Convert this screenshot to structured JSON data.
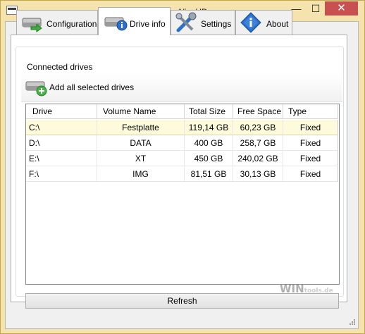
{
  "window": {
    "title": "KeepAliveHD",
    "buttons": {
      "minimize": "—",
      "maximize": "☐",
      "close": "✕"
    }
  },
  "tabs": [
    {
      "label": "Configuration",
      "icon": "drive-arrow-icon",
      "active": false
    },
    {
      "label": "Drive info",
      "icon": "drive-info-icon",
      "active": true
    },
    {
      "label": "Settings",
      "icon": "tools-icon",
      "active": false
    },
    {
      "label": "About",
      "icon": "info-diamond-icon",
      "active": false
    }
  ],
  "group": {
    "title": "Connected drives",
    "add_label": "Add all selected drives",
    "add_icon": "drive-add-icon"
  },
  "table": {
    "columns": [
      "Drive",
      "Volume Name",
      "Total Size",
      "Free Space",
      "Type"
    ],
    "rows": [
      {
        "drive": "C:\\",
        "volume": "Festplatte",
        "total": "119,14 GB",
        "free": "60,23 GB",
        "type": "Fixed",
        "selected": true
      },
      {
        "drive": "D:\\",
        "volume": "DATA",
        "total": "400 GB",
        "free": "258,7 GB",
        "type": "Fixed",
        "selected": false
      },
      {
        "drive": "E:\\",
        "volume": "XT",
        "total": "450 GB",
        "free": "240,02 GB",
        "type": "Fixed",
        "selected": false
      },
      {
        "drive": "F:\\",
        "volume": "IMG",
        "total": "81,51 GB",
        "free": "30,13 GB",
        "type": "Fixed",
        "selected": false
      }
    ]
  },
  "refresh_label": "Refresh",
  "watermark": {
    "main": "WIN",
    "sub": "tools.de"
  },
  "colors": {
    "frame": "#f4e3ad",
    "close": "#c75050",
    "selected_row": "#fdfbdb"
  }
}
